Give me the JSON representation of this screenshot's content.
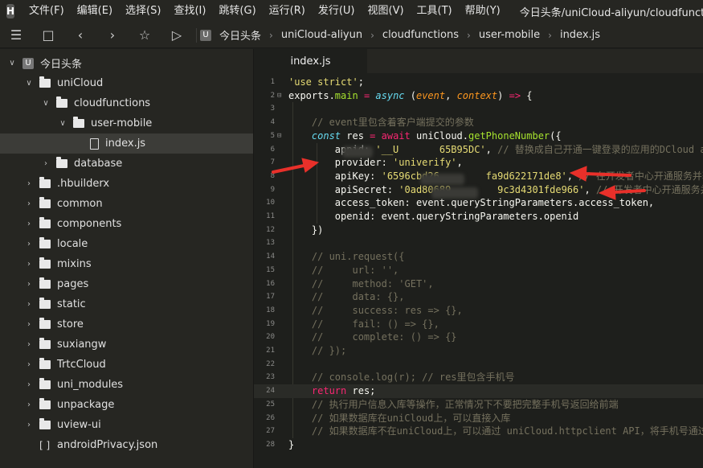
{
  "app": {
    "logo_letter": "H"
  },
  "menu": [
    "文件(F)",
    "编辑(E)",
    "选择(S)",
    "查找(I)",
    "跳转(G)",
    "运行(R)",
    "发行(U)",
    "视图(V)",
    "工具(T)",
    "帮助(Y)"
  ],
  "window_title": "今日头条/uniCloud-aliyun/cloudfunctions/us",
  "toolbar": {
    "breadcrumb": [
      "今日头条",
      "uniCloud-aliyun",
      "cloudfunctions",
      "user-mobile",
      "index.js"
    ],
    "icons": [
      "save-all-icon",
      "save-icon",
      "back-icon",
      "forward-icon",
      "star-icon",
      "run-icon"
    ]
  },
  "sidebar": {
    "items": [
      {
        "label": "今日头条",
        "depth": 0,
        "expanded": true,
        "kind": "project"
      },
      {
        "label": "uniCloud",
        "depth": 1,
        "expanded": true,
        "kind": "folder"
      },
      {
        "label": "cloudfunctions",
        "depth": 2,
        "expanded": true,
        "kind": "folder"
      },
      {
        "label": "user-mobile",
        "depth": 3,
        "expanded": true,
        "kind": "folder"
      },
      {
        "label": "index.js",
        "depth": 4,
        "kind": "file",
        "selected": true
      },
      {
        "label": "database",
        "depth": 2,
        "expanded": false,
        "kind": "folder"
      },
      {
        "label": ".hbuilderx",
        "depth": 1,
        "expanded": false,
        "kind": "folder"
      },
      {
        "label": "common",
        "depth": 1,
        "expanded": false,
        "kind": "folder"
      },
      {
        "label": "components",
        "depth": 1,
        "expanded": false,
        "kind": "folder"
      },
      {
        "label": "locale",
        "depth": 1,
        "expanded": false,
        "kind": "folder"
      },
      {
        "label": "mixins",
        "depth": 1,
        "expanded": false,
        "kind": "folder"
      },
      {
        "label": "pages",
        "depth": 1,
        "expanded": false,
        "kind": "folder"
      },
      {
        "label": "static",
        "depth": 1,
        "expanded": false,
        "kind": "folder"
      },
      {
        "label": "store",
        "depth": 1,
        "expanded": false,
        "kind": "folder"
      },
      {
        "label": "suxiangw",
        "depth": 1,
        "expanded": false,
        "kind": "folder"
      },
      {
        "label": "TrtcCloud",
        "depth": 1,
        "expanded": false,
        "kind": "folder"
      },
      {
        "label": "uni_modules",
        "depth": 1,
        "expanded": false,
        "kind": "folder"
      },
      {
        "label": "unpackage",
        "depth": 1,
        "expanded": false,
        "kind": "folder"
      },
      {
        "label": "uview-ui",
        "depth": 1,
        "expanded": false,
        "kind": "folder"
      },
      {
        "label": "androidPrivacy.json",
        "depth": 1,
        "kind": "json"
      }
    ]
  },
  "editor": {
    "active_tab": "index.js",
    "highlighted_line": 24,
    "lines": [
      [
        [
          "s",
          "'use strict'"
        ],
        [
          "w",
          ";"
        ]
      ],
      [
        [
          "w",
          "exports."
        ],
        [
          "f",
          "main"
        ],
        [
          "w",
          " "
        ],
        [
          "k",
          "="
        ],
        [
          "w",
          " "
        ],
        [
          "b",
          "async"
        ],
        [
          "w",
          " ("
        ],
        [
          "p",
          "event"
        ],
        [
          "w",
          ", "
        ],
        [
          "p",
          "context"
        ],
        [
          "w",
          ") "
        ],
        [
          "k",
          "=>"
        ],
        [
          "w",
          " {"
        ]
      ],
      [],
      [
        [
          "c",
          "    // event里包含着客户端提交的参数"
        ]
      ],
      [
        [
          "w",
          "    "
        ],
        [
          "b",
          "const"
        ],
        [
          "w",
          " res "
        ],
        [
          "k",
          "="
        ],
        [
          "w",
          " "
        ],
        [
          "k",
          "await"
        ],
        [
          "w",
          " uniCloud."
        ],
        [
          "f",
          "getPhoneNumber"
        ],
        [
          "w",
          "({"
        ]
      ],
      [
        [
          "w",
          "        appid: "
        ],
        [
          "s",
          "'__U       65B95DC'"
        ],
        [
          "w",
          ", "
        ],
        [
          "c",
          "// 替换成自己开通一键登录的应用的DCloud appid，使"
        ]
      ],
      [
        [
          "w",
          "        provider: "
        ],
        [
          "s",
          "'univerify'"
        ],
        [
          "w",
          ","
        ]
      ],
      [
        [
          "w",
          "        apiKey: "
        ],
        [
          "s",
          "'6596cbd26        fa9d622171de8'"
        ],
        [
          "w",
          ", "
        ],
        [
          "c",
          "// 在开发者中心开通服务并获"
        ]
      ],
      [
        [
          "w",
          "        apiSecret: "
        ],
        [
          "s",
          "'0ad80689        9c3d4301fde966'"
        ],
        [
          "w",
          ", "
        ],
        [
          "c",
          "// 开发者中心开通服务并"
        ]
      ],
      [
        [
          "w",
          "        access_token: event.queryStringParameters.access_token,"
        ]
      ],
      [
        [
          "w",
          "        openid: event.queryStringParameters.openid"
        ]
      ],
      [
        [
          "w",
          "    })"
        ]
      ],
      [],
      [
        [
          "c",
          "    // uni.request({"
        ]
      ],
      [
        [
          "c",
          "    //     url: '',"
        ]
      ],
      [
        [
          "c",
          "    //     method: 'GET',"
        ]
      ],
      [
        [
          "c",
          "    //     data: {},"
        ]
      ],
      [
        [
          "c",
          "    //     success: res => {},"
        ]
      ],
      [
        [
          "c",
          "    //     fail: () => {},"
        ]
      ],
      [
        [
          "c",
          "    //     complete: () => {}"
        ]
      ],
      [
        [
          "c",
          "    // });"
        ]
      ],
      [],
      [
        [
          "c",
          "    // console.log(r); // res里包含手机号"
        ]
      ],
      [
        [
          "w",
          "    "
        ],
        [
          "k",
          "return"
        ],
        [
          "w",
          " res;"
        ]
      ],
      [
        [
          "c",
          "    // 执行用户信息入库等操作，正常情况下不要把完整手机号返回给前端"
        ]
      ],
      [
        [
          "c",
          "    // 如果数据库在uniCloud上，可以直接入库"
        ]
      ],
      [
        [
          "c",
          "    // 如果数据库不在uniCloud上，可以通过 uniCloud.httpclient API，将手机号通过htt"
        ]
      ],
      [
        [
          "w",
          "}"
        ]
      ]
    ]
  },
  "colors": {
    "string": "#e6db74",
    "keyword": "#f92672",
    "function": "#a6e22e",
    "param": "#fd971f",
    "comment": "#75715e",
    "storage": "#66d9ef",
    "annotation_arrow": "#e8302a"
  }
}
